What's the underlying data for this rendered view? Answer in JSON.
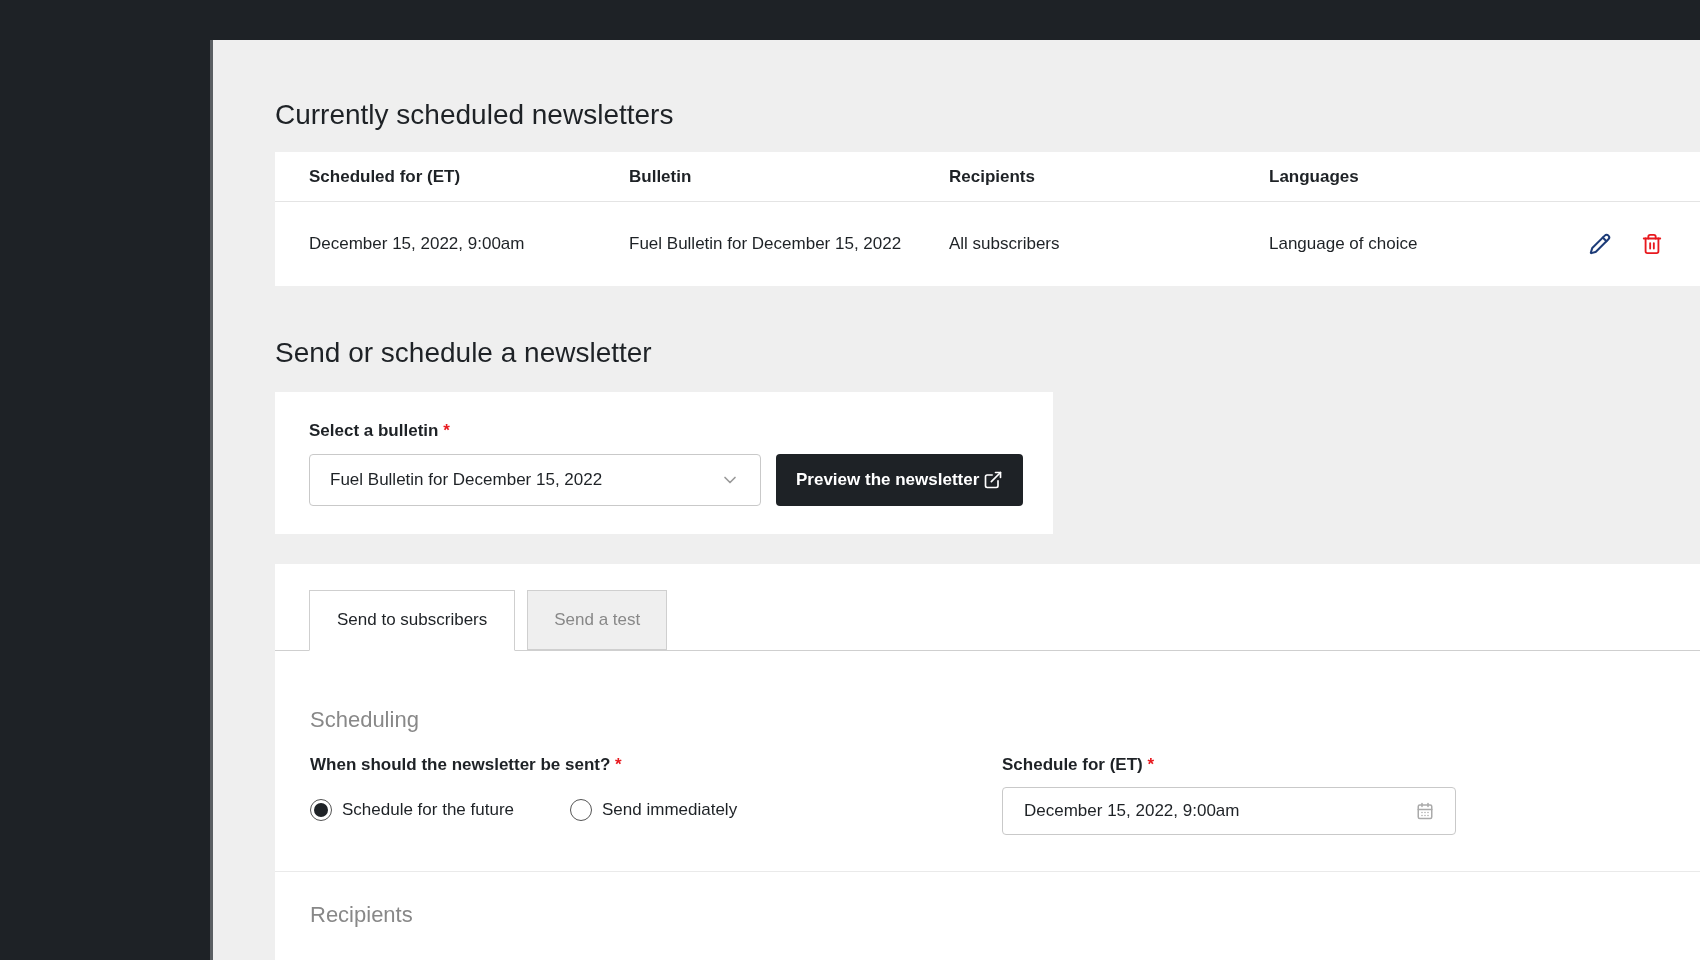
{
  "scheduled": {
    "title": "Currently scheduled newsletters",
    "columns": [
      "Scheduled for (ET)",
      "Bulletin",
      "Recipients",
      "Languages"
    ],
    "rows": [
      {
        "cells": [
          "December 15, 2022, 9:00am",
          "Fuel Bulletin for December 15, 2022",
          "All subscribers",
          "Language of choice"
        ]
      }
    ]
  },
  "send": {
    "title": "Send or schedule a newsletter",
    "bulletin_label": "Select a bulletin",
    "required_mark": "*",
    "bulletin_value": "Fuel Bulletin for December 15, 2022",
    "preview_button": "Preview the newsletter",
    "tabs": [
      {
        "label": "Send to subscribers",
        "selected": true
      },
      {
        "label": "Send a test",
        "selected": false
      }
    ],
    "scheduling": {
      "title": "Scheduling",
      "question": "When should the newsletter be sent?",
      "required_mark": "*",
      "options": [
        {
          "label": "Schedule for the future",
          "selected": true
        },
        {
          "label": "Send immediately",
          "selected": false
        }
      ],
      "date_label": "Schedule for (ET)",
      "date_required_mark": "*",
      "date_value": "December 15, 2022, 9:00am"
    },
    "recipients_title": "Recipients"
  }
}
